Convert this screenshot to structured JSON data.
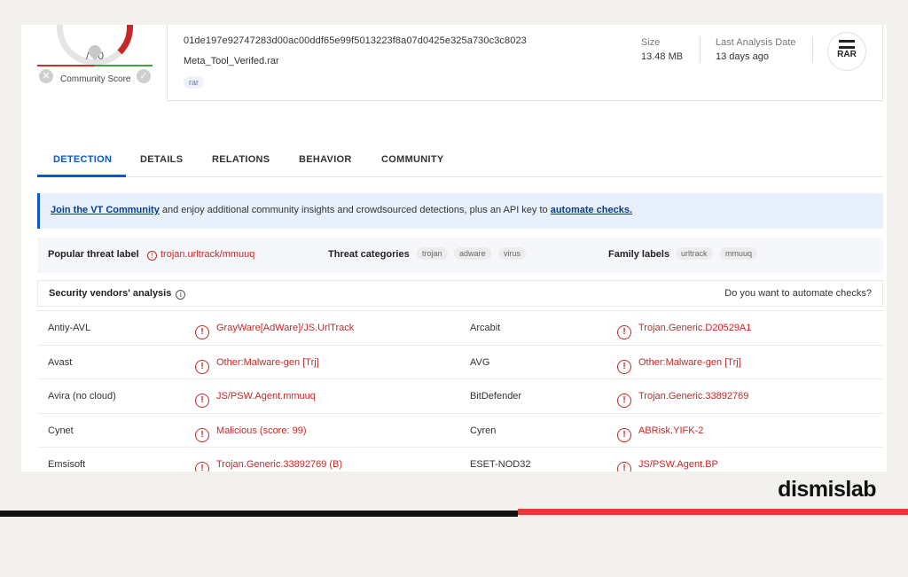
{
  "score": {
    "total": "/ 60",
    "community_label": "Community Score"
  },
  "file": {
    "hash": "01de197e92747283d00ac00ddf65e99f5013223f8a07d0425e325a730c3c8023",
    "name": "Meta_Tool_Verifed.rar",
    "tag": "rar",
    "size_label": "Size",
    "size_value": "13.48 MB",
    "date_label": "Last Analysis Date",
    "date_value": "13 days ago",
    "type_label": "RAR"
  },
  "tabs": [
    "DETECTION",
    "DETAILS",
    "RELATIONS",
    "BEHAVIOR",
    "COMMUNITY"
  ],
  "banner": {
    "link1": "Join the VT Community",
    "text": " and enjoy additional community insights and crowdsourced detections, plus an API key to ",
    "link2": "automate checks."
  },
  "threat": {
    "popular_label": "Popular threat label",
    "popular_value": "trojan.urltrack/mmuuq",
    "categories_label": "Threat categories",
    "categories": [
      "trojan",
      "adware",
      "virus"
    ],
    "family_label": "Family labels",
    "families": [
      "urltrack",
      "mmuuq"
    ]
  },
  "vendors_header": {
    "title": "Security vendors' analysis",
    "right": "Do you want to automate checks?"
  },
  "vendors": [
    {
      "v1": "Antiy-AVL",
      "d1": "GrayWare[AdWare]/JS.UrlTrack",
      "v2": "Arcabit",
      "d2": "Trojan.Generic.D20529A1"
    },
    {
      "v1": "Avast",
      "d1": "Other:Malware-gen [Trj]",
      "v2": "AVG",
      "d2": "Other:Malware-gen [Trj]"
    },
    {
      "v1": "Avira (no cloud)",
      "d1": "JS/PSW.Agent.mmuuq",
      "v2": "BitDefender",
      "d2": "Trojan.Generic.33892769"
    },
    {
      "v1": "Cynet",
      "d1": "Malicious (score: 99)",
      "v2": "Cyren",
      "d2": "ABRisk.YIFK-2"
    },
    {
      "v1": "Emsisoft",
      "d1": "Trojan.Generic.33892769 (B)",
      "v2": "ESET-NOD32",
      "d2": "JS/PSW.Agent.BP"
    }
  ],
  "brand": "dismislab",
  "colors": {
    "accent": "#0b57d0",
    "danger": "#c62828",
    "stripe_red": "#e53935"
  }
}
